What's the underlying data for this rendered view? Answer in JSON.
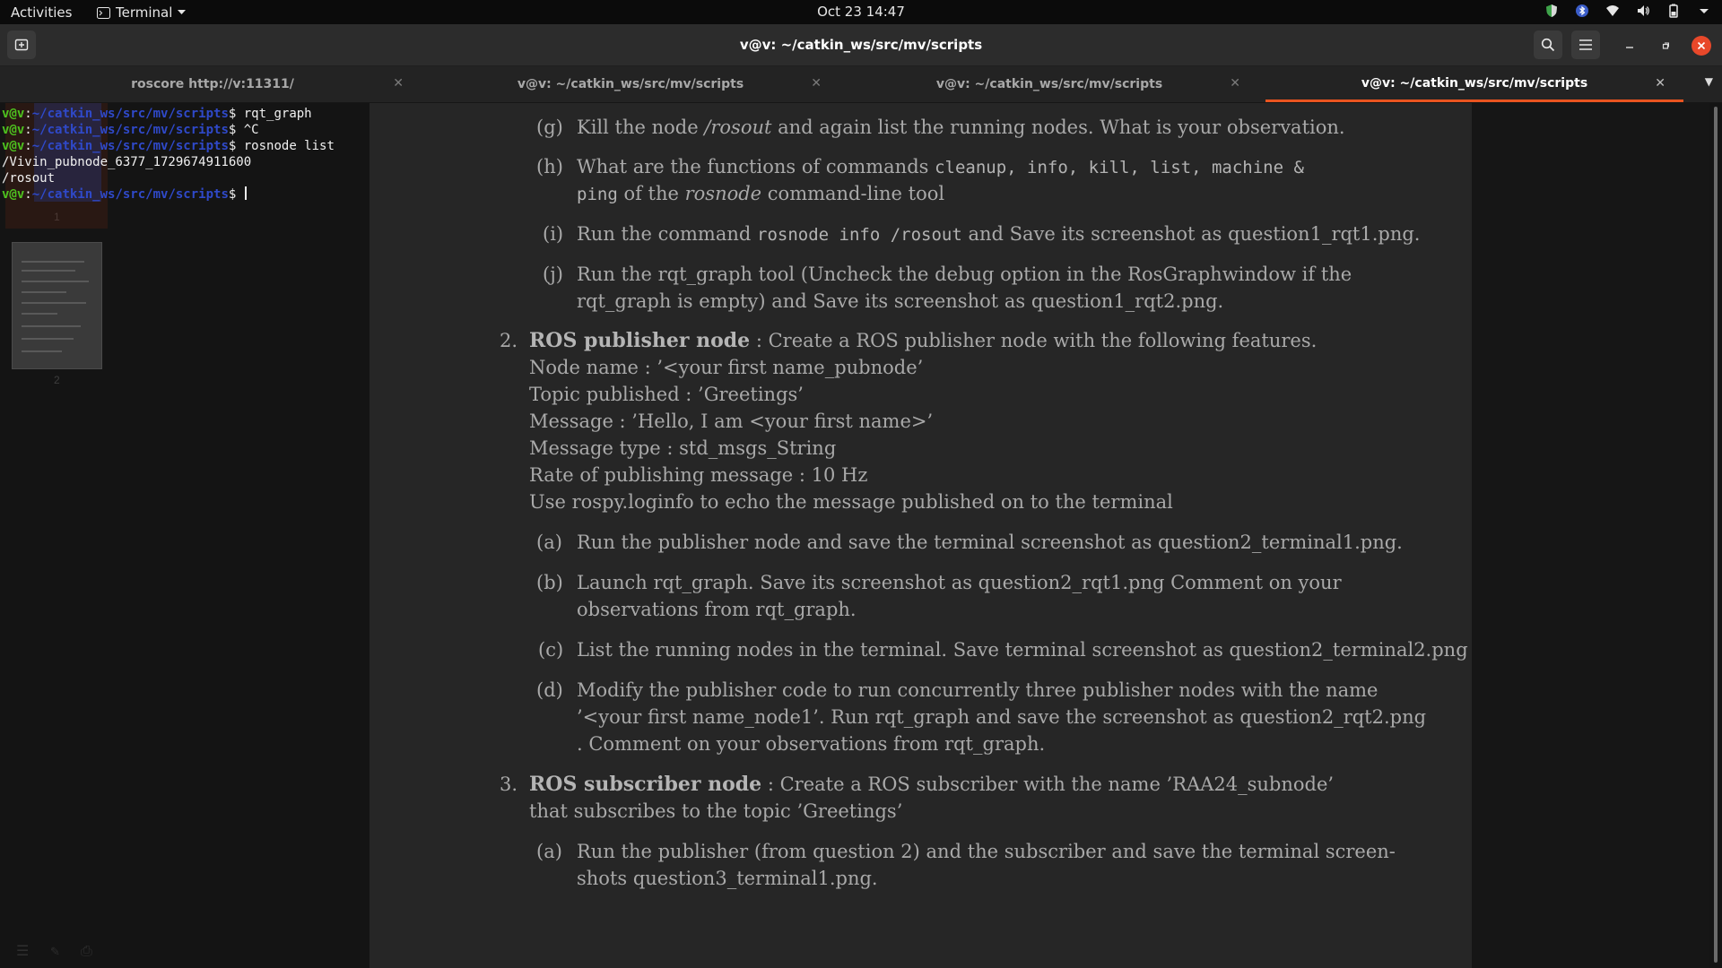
{
  "topbar": {
    "activities": "Activities",
    "app_name": "Terminal",
    "clock": "Oct 23  14:47",
    "tray_icons": [
      "shield-icon",
      "bluetooth-icon",
      "wifi-icon",
      "volume-icon",
      "battery-icon",
      "chevron-down-icon"
    ]
  },
  "window": {
    "title": "v@v: ~/catkin_ws/src/mv/scripts",
    "buttons": [
      "new-tab-icon",
      "search-icon",
      "hamburger-menu-icon",
      "minimize-icon",
      "maximize-icon",
      "close-icon"
    ]
  },
  "tabs": [
    {
      "label": "roscore http://v:11311/",
      "active": false
    },
    {
      "label": "v@v: ~/catkin_ws/src/mv/scripts",
      "active": false
    },
    {
      "label": "v@v: ~/catkin_ws/src/mv/scripts",
      "active": false
    },
    {
      "label": "v@v: ~/catkin_ws/src/mv/scripts",
      "active": true
    }
  ],
  "terminal": {
    "user": "v@v",
    "path": "~/catkin_ws/src/mv/scripts",
    "lines": [
      {
        "type": "prompt",
        "cmd": "rqt_graph"
      },
      {
        "type": "prompt",
        "cmd": "^C"
      },
      {
        "type": "prompt",
        "cmd": "rosnode list"
      },
      {
        "type": "output",
        "text": "/Vivin_pubnode_6377_1729674911600"
      },
      {
        "type": "output",
        "text": "/rosout"
      },
      {
        "type": "prompt",
        "cmd": ""
      }
    ]
  },
  "ghost": {
    "page_num_1": "1",
    "page_num_2": "2"
  },
  "doc": {
    "g": {
      "label": "(g)",
      "t1": "Kill the node ",
      "t2": "/rosout",
      "t3": " and again list the running nodes. What is your observation."
    },
    "h": {
      "label": "(h)",
      "t1": "What are the functions of commands ",
      "c1": "cleanup, info, kill, list, machine &",
      "c2": "ping",
      "t2": " of the ",
      "t3": "rosnode",
      "t4": " command-line tool"
    },
    "i": {
      "label": "(i)",
      "t1": "Run the command ",
      "c1": "rosnode info /rosout",
      "t2": " and Save its screenshot as question1_rqt1.png."
    },
    "j": {
      "label": "(j)",
      "l1": "Run the rqt_graph tool (Uncheck the debug option in the RosGraphwindow if the",
      "l2": "rqt_graph is empty) and Save its screenshot as question1_rqt2.png."
    },
    "q2": {
      "num": "2.",
      "title": "ROS publisher node",
      "intro": " : Create a ROS publisher node with the following features.",
      "lines": [
        "Node name : ’<your first name_pubnode’",
        "Topic published : ’Greetings’",
        "Message : ’Hello, I am <your first name>’",
        "Message type : std_msgs_String",
        "Rate of publishing message : 10 Hz",
        "Use rospy.loginfo to echo the message published on to the terminal"
      ],
      "a": {
        "label": "(a)",
        "l1": "Run the publisher node and save the terminal screenshot as question2_terminal1.png."
      },
      "b": {
        "label": "(b)",
        "l1": "Launch rqt_graph.  Save its screenshot as question2_rqt1.png Comment on your",
        "l2": "observations from rqt_graph."
      },
      "c": {
        "label": "(c)",
        "l1": "List the running nodes in the terminal.  Save terminal screenshot as question2_terminal2.png"
      },
      "d": {
        "label": "(d)",
        "l1": "Modify the publisher code to run concurrently three publisher nodes with the name",
        "l2": "’<your first name_node1’.  Run rqt_graph and save the screenshot as question2_rqt2.png",
        "l3": ". Comment on your observations from rqt_graph."
      }
    },
    "q3": {
      "num": "3.",
      "title": "ROS subscriber node",
      "intro": " :  Create a ROS subscriber with the name ’RAA24_subnode’",
      "l2": "that subscribes to the topic ’Greetings’",
      "a": {
        "label": "(a)",
        "l1": "Run the publisher (from question 2) and the subscriber and save the terminal screen-",
        "l2": "shots question3_terminal1.png."
      }
    }
  }
}
